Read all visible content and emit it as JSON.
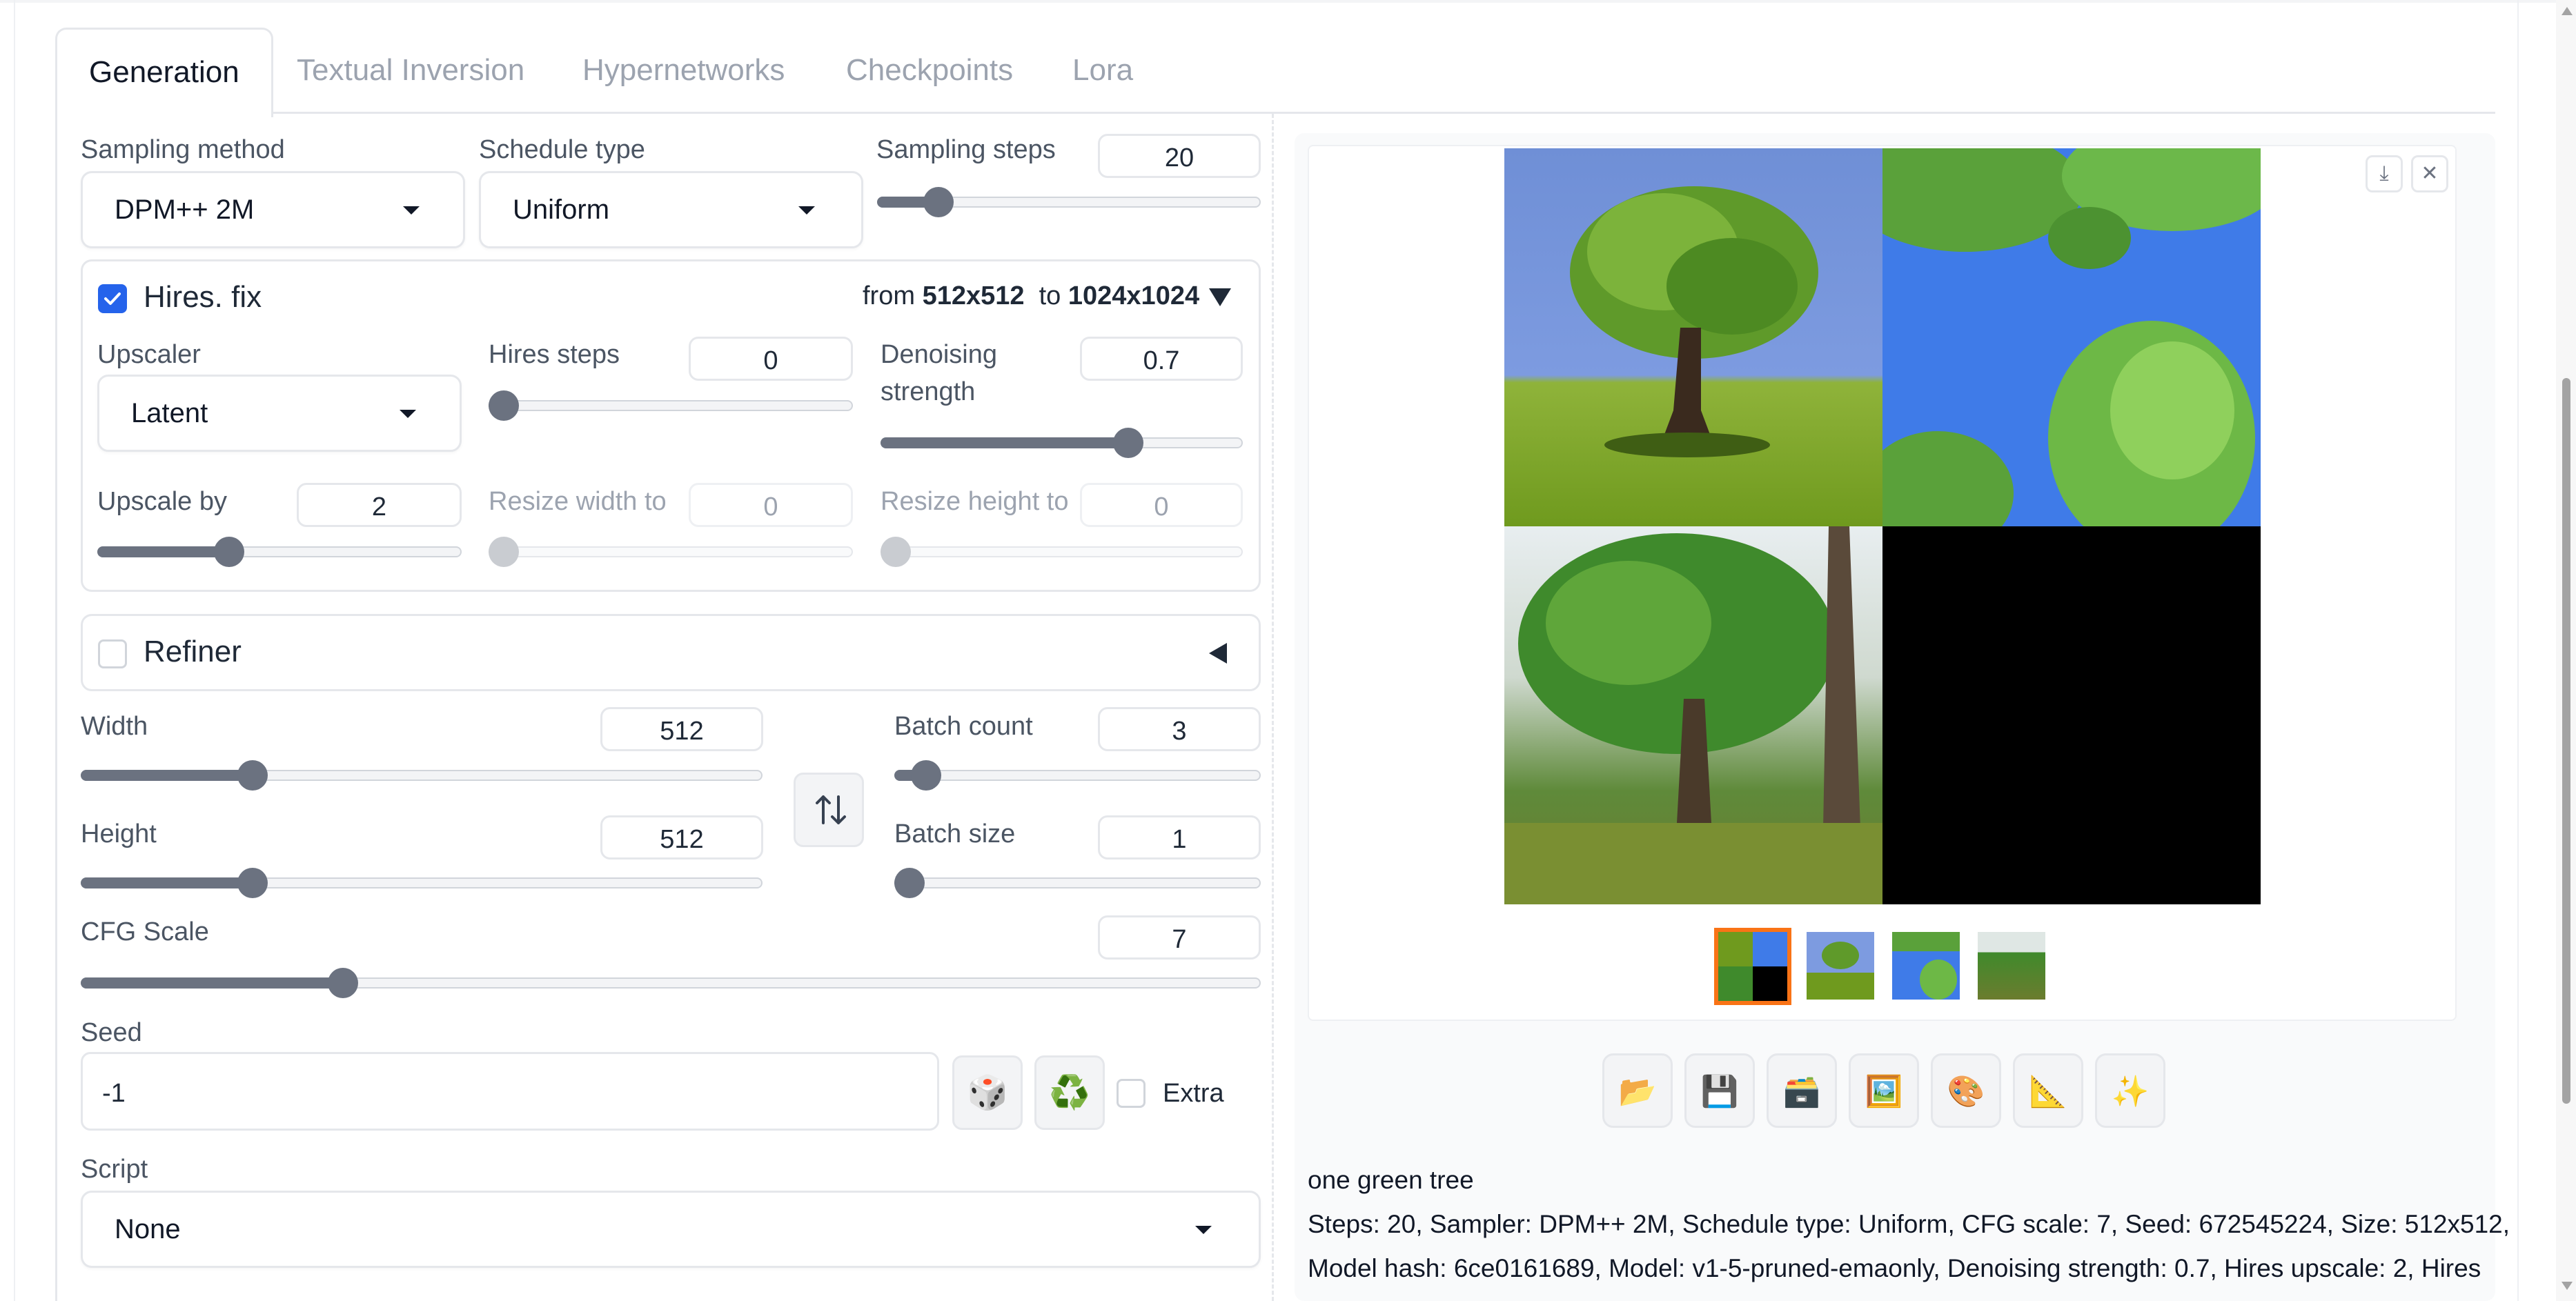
{
  "tabs": [
    "Generation",
    "Textual Inversion",
    "Hypernetworks",
    "Checkpoints",
    "Lora"
  ],
  "sampling": {
    "method_label": "Sampling method",
    "method_value": "DPM++ 2M",
    "schedule_label": "Schedule type",
    "schedule_value": "Uniform",
    "steps_label": "Sampling steps",
    "steps_value": "20",
    "steps_fraction": 0.13
  },
  "hires": {
    "title": "Hires. fix",
    "summary_from_prefix": "from",
    "summary_from": "512x512",
    "summary_to_prefix": "to",
    "summary_to": "1024x1024",
    "upscaler_label": "Upscaler",
    "upscaler_value": "Latent",
    "steps_label": "Hires steps",
    "steps_value": "0",
    "steps_fraction": 0.0,
    "denoise_label_1": "Denoising",
    "denoise_label_2": "strength",
    "denoise_value": "0.7",
    "denoise_fraction": 0.7,
    "upscale_label": "Upscale by",
    "upscale_value": "2",
    "upscale_fraction": 0.35,
    "resize_w_label": "Resize width to",
    "resize_w_value": "0",
    "resize_h_label": "Resize height to",
    "resize_h_value": "0"
  },
  "refiner": {
    "title": "Refiner"
  },
  "size": {
    "width_label": "Width",
    "width_value": "512",
    "width_fraction": 0.24,
    "height_label": "Height",
    "height_value": "512",
    "height_fraction": 0.24,
    "batch_count_label": "Batch count",
    "batch_count_value": "3",
    "batch_count_fraction": 0.05,
    "batch_size_label": "Batch size",
    "batch_size_value": "1",
    "batch_size_fraction": 0.0,
    "swap_icon": "swap-vertical-icon"
  },
  "cfg": {
    "label": "CFG Scale",
    "value": "7",
    "fraction": 0.215
  },
  "seed": {
    "label": "Seed",
    "value": "-1",
    "extra_label": "Extra",
    "dice_icon": "🎲",
    "recycle_icon": "♻️"
  },
  "script": {
    "label": "Script",
    "value": "None"
  },
  "tools": [
    "📂",
    "💾",
    "🗃️",
    "🖼️",
    "🎨",
    "📐",
    "✨"
  ],
  "output": {
    "prompt": "one green tree",
    "params_line1": "Steps: 20, Sampler: DPM++ 2M, Schedule type: Uniform, CFG scale: 7, Seed: 672545224, Size: 512x512,",
    "params_line2": "Model hash: 6ce0161689, Model: v1-5-pruned-emaonly, Denoising strength: 0.7, Hires upscale: 2, Hires"
  },
  "colors": {
    "accent": "#2563eb",
    "selected_thumb": "#f97316",
    "slider": "#6b7280"
  }
}
